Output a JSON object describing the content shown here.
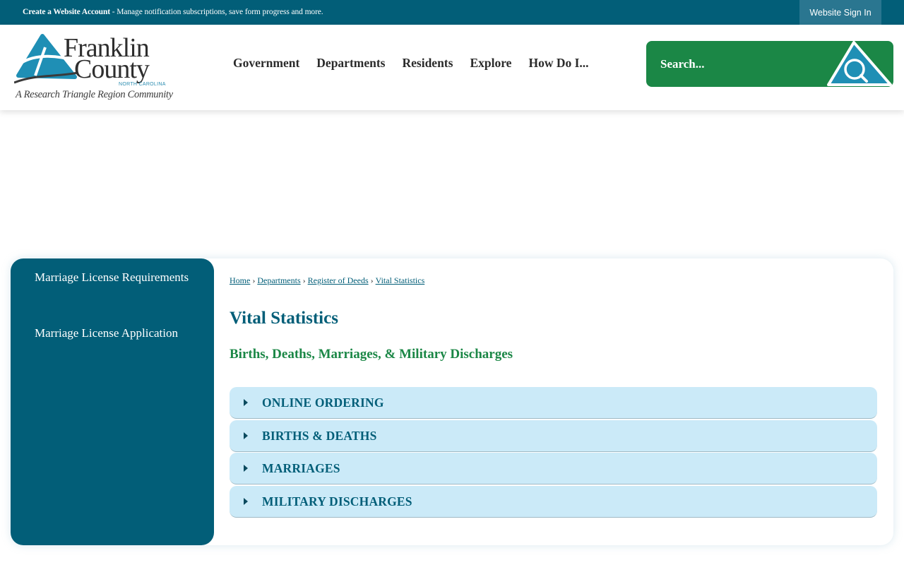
{
  "topbar": {
    "account_link": "Create a Website Account",
    "account_desc": " - Manage notification subscriptions, save form progress and more.",
    "sign_in": "Website Sign In"
  },
  "logo": {
    "line1": "Franklin",
    "line2": "County",
    "state": "NORTH CAROLINA",
    "tagline": "A Research Triangle Region Community"
  },
  "nav": {
    "items": [
      "Government",
      "Departments",
      "Residents",
      "Explore",
      "How Do I..."
    ]
  },
  "search": {
    "placeholder": "Search...",
    "icon": "search-icon"
  },
  "sidebar": {
    "items": [
      "Marriage License Requirements",
      "Marriage License Application"
    ]
  },
  "breadcrumb": {
    "items": [
      "Home",
      "Departments",
      "Register of Deeds",
      "Vital Statistics"
    ],
    "separator": "›"
  },
  "main": {
    "title": "Vital Statistics",
    "subtitle": "Births, Deaths, Marriages, & Military Discharges",
    "accordion": [
      "ONLINE ORDERING",
      "BIRTHS & DEATHS",
      "MARRIAGES",
      "MILITARY DISCHARGES"
    ]
  },
  "colors": {
    "primary_teal": "#025e78",
    "green": "#1b8746",
    "accordion_bg": "#cbeaf8",
    "logo_blue": "#1f8fb5"
  }
}
